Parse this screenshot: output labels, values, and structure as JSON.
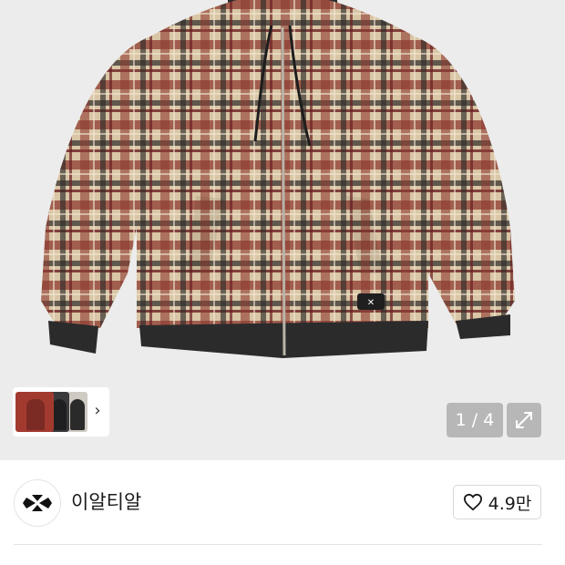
{
  "product": {
    "image_alt_icon": "plaid-hooded-jacket-image",
    "colors": {
      "plaid_red": "#8e3a30",
      "plaid_cream": "#d8c5a5",
      "plaid_dark": "#2c2a28",
      "rib": "#2b2b2b",
      "background": "#ececec"
    }
  },
  "gallery": {
    "counter": "1 / 4",
    "next_icon": "chevron-right-icon",
    "expand_icon": "expand-icon"
  },
  "brand": {
    "name": "이알티알",
    "logo_icon": "brand-logo-icon",
    "like_icon": "heart-icon",
    "like_count": "4.9만"
  }
}
